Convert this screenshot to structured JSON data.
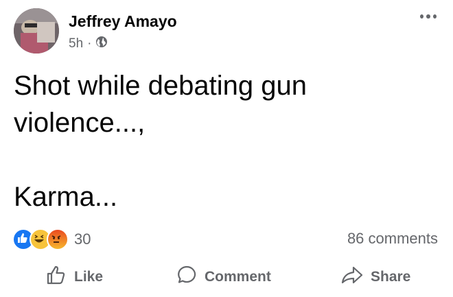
{
  "post": {
    "author": "Jeffrey Amayo",
    "time": "5h",
    "separator": "·",
    "line1": "Shot while debating gun\nviolence...,",
    "line2": "Karma..."
  },
  "stats": {
    "reaction_count": "30",
    "comments": "86 comments",
    "reaction_icons": [
      "like-icon",
      "haha-icon",
      "angry-icon"
    ]
  },
  "actions": {
    "like": "Like",
    "comment": "Comment",
    "share": "Share"
  },
  "colors": {
    "text": "#050505",
    "muted": "#65676b",
    "like_blue": "#1877f2",
    "haha_yellow": "#f7c33b",
    "angry_red": "#e9710f"
  }
}
